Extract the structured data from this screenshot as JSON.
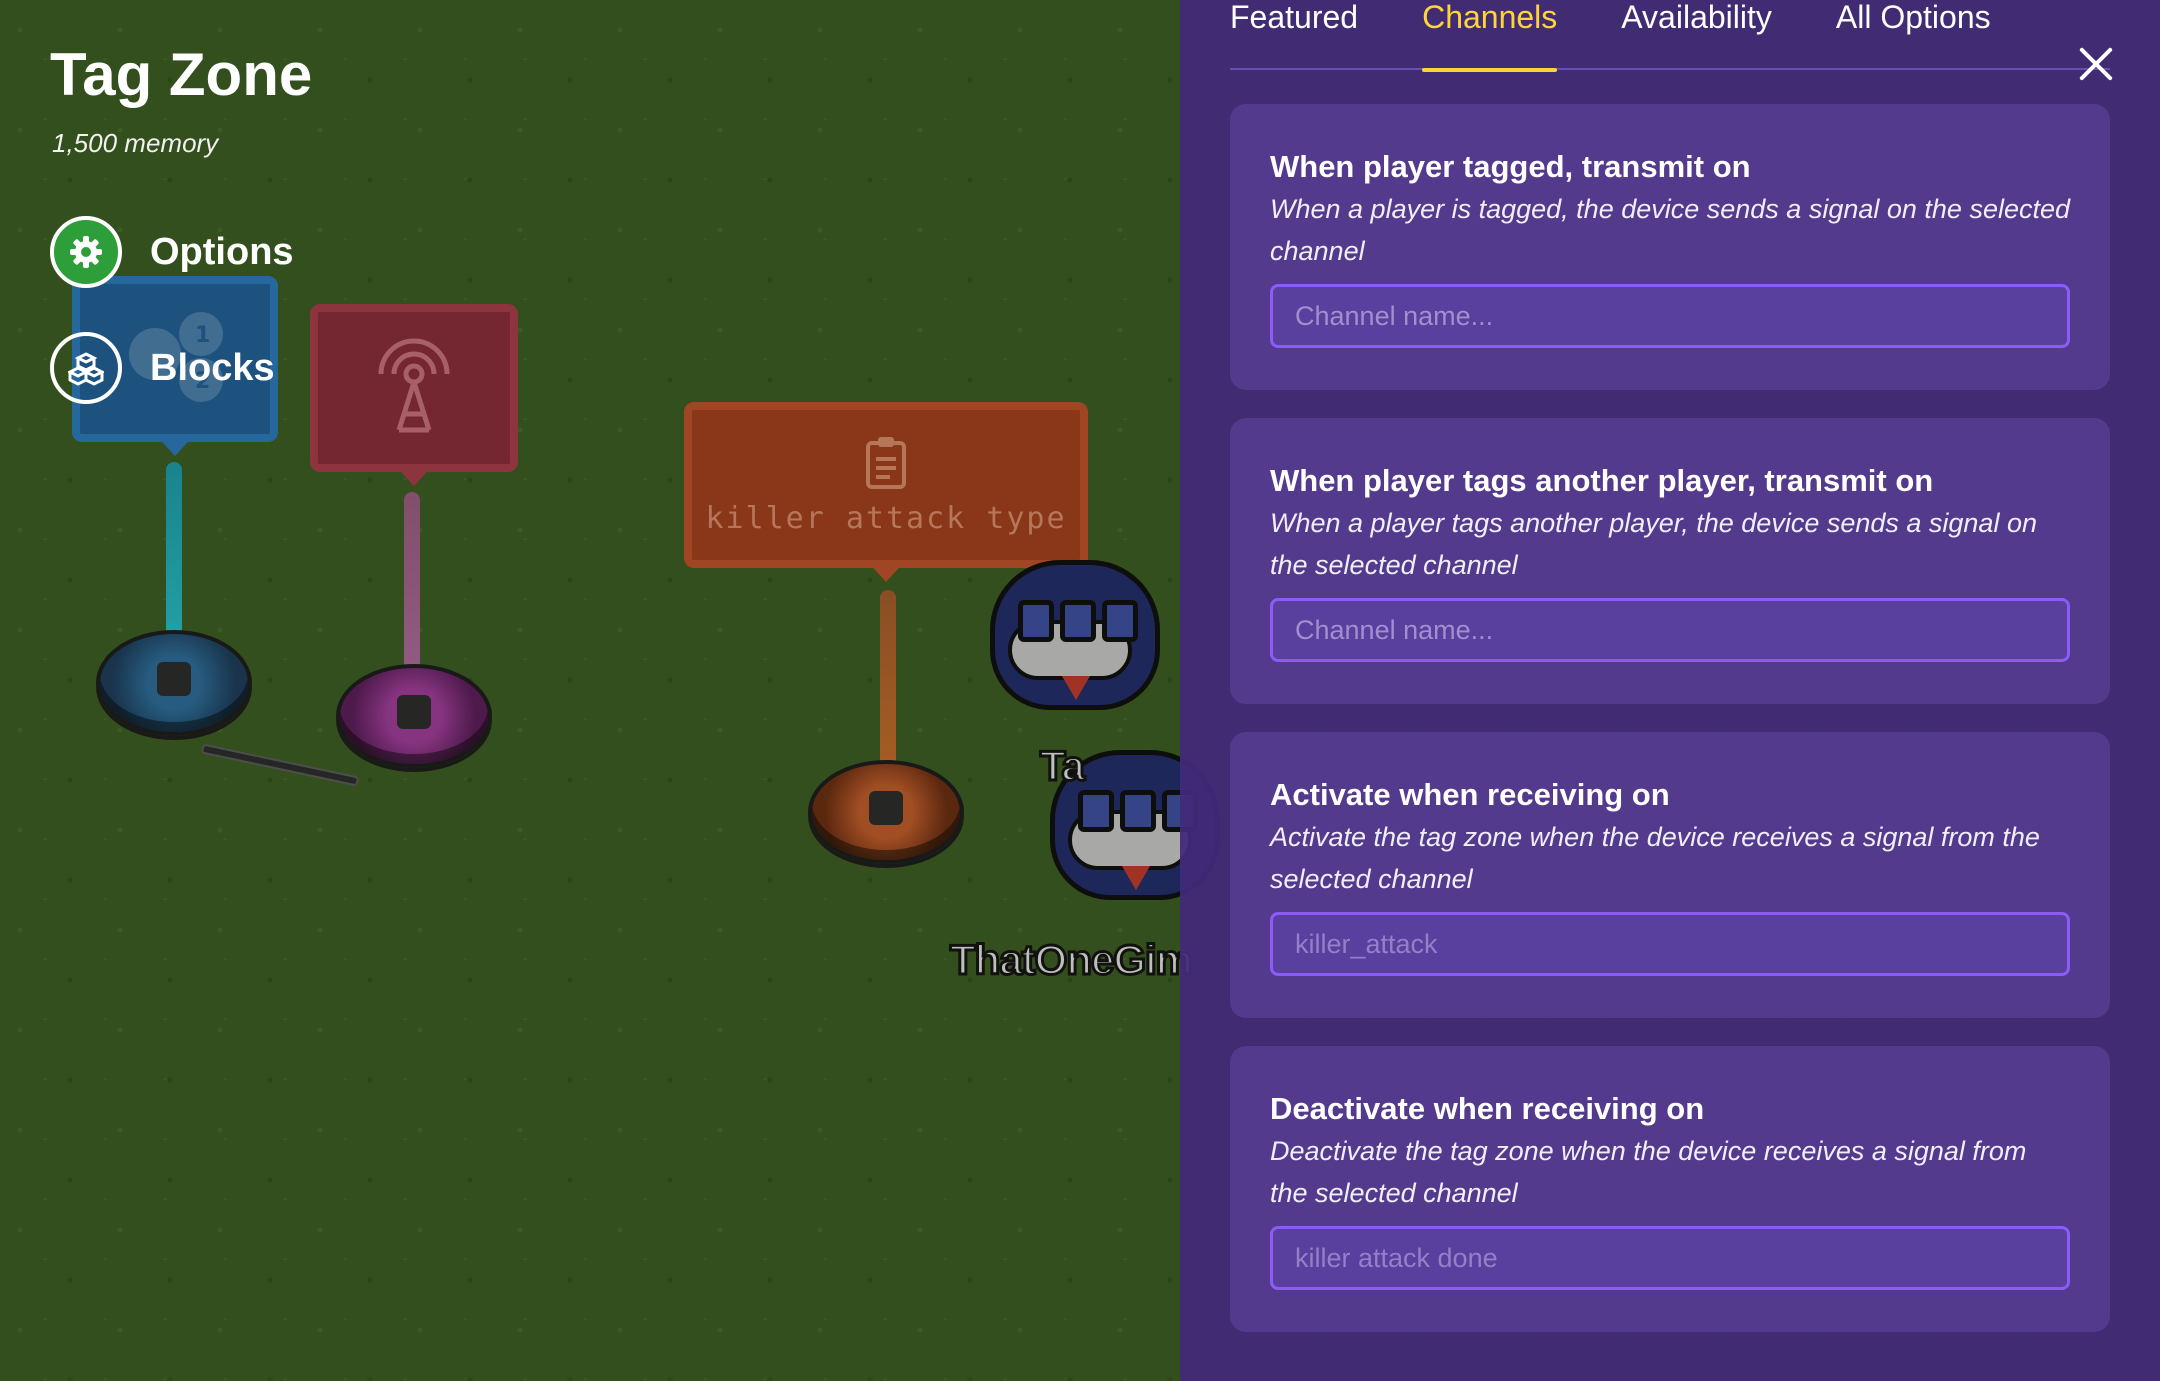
{
  "device": {
    "title": "Tag Zone",
    "memory": "1,500 memory"
  },
  "side_menu": [
    {
      "label": "Options",
      "icon": "gear-icon",
      "color": "#2e9e3a"
    },
    {
      "label": "Blocks",
      "icon": "blocks-icon",
      "color": "transparent"
    }
  ],
  "world": {
    "sign_text": "killer attack type",
    "player_name": "ThatOneGim",
    "partial_name": "Ta"
  },
  "tabs": [
    {
      "label": "Featured",
      "active": false
    },
    {
      "label": "Channels",
      "active": true
    },
    {
      "label": "Availability",
      "active": false
    },
    {
      "label": "All Options",
      "active": false
    }
  ],
  "channels": [
    {
      "title": "When player tagged, transmit on",
      "description": "When a player is tagged, the device sends a signal on the selected channel",
      "value": "",
      "placeholder": "Channel name..."
    },
    {
      "title": "When player tags another player, transmit on",
      "description": "When a player tags another player, the device sends a signal on the selected channel",
      "value": "",
      "placeholder": "Channel name..."
    },
    {
      "title": "Activate when receiving on",
      "description": "Activate the tag zone when the device receives a signal from the selected channel",
      "value": "killer_attack",
      "placeholder": "Channel name..."
    },
    {
      "title": "Deactivate when receiving on",
      "description": "Deactivate the tag zone when the device receives a signal from the selected channel",
      "value": "killer attack done",
      "placeholder": "Channel name..."
    }
  ],
  "colors": {
    "accent_tab": "#ffd43b",
    "panel_bg": "#422a7a",
    "input_border": "#8b5cf6",
    "options_green": "#2e9e3a"
  }
}
